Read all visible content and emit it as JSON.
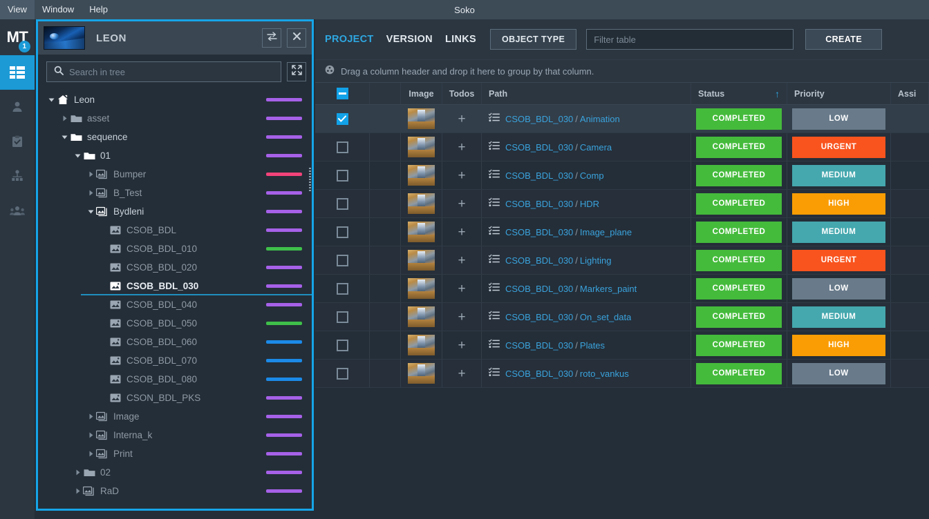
{
  "window": {
    "title": "Soko"
  },
  "menubar": {
    "items": [
      {
        "label": "View"
      },
      {
        "label": "Window"
      },
      {
        "label": "Help"
      }
    ]
  },
  "rail": {
    "logo_text": "MT",
    "badge_count": "1",
    "items": [
      {
        "name": "grid-icon",
        "label": "Projects",
        "active": true
      },
      {
        "name": "user-icon",
        "label": "User",
        "active": false
      },
      {
        "name": "clipboard-check-icon",
        "label": "Tasks",
        "active": false
      },
      {
        "name": "person-network-icon",
        "label": "Assignments",
        "active": false
      },
      {
        "name": "group-users-icon",
        "label": "Teams",
        "active": false
      }
    ]
  },
  "tree_panel": {
    "title": "LEON",
    "thumbnail_alt": "leon-project-thumbnail",
    "swap_button_label": "⇄",
    "close_button_label": "✕",
    "collapse_button_label": "collapse-all",
    "search": {
      "placeholder": "Search in tree",
      "value": ""
    },
    "nodes": [
      {
        "label": "Leon",
        "depth": 0,
        "icon": "home-icon",
        "caret": "down",
        "color": "#a661e8",
        "emphasis": "mid"
      },
      {
        "label": "asset",
        "depth": 1,
        "icon": "folder-icon",
        "caret": "right",
        "color": "#a661e8",
        "emphasis": "dim"
      },
      {
        "label": "sequence",
        "depth": 1,
        "icon": "folder-icon",
        "caret": "down",
        "color": "#a661e8",
        "emphasis": "mid"
      },
      {
        "label": "01",
        "depth": 2,
        "icon": "folder-icon",
        "caret": "down",
        "color": "#a661e8",
        "emphasis": "mid"
      },
      {
        "label": "Bumper",
        "depth": 3,
        "icon": "shots-icon",
        "caret": "right",
        "color": "#f2437a",
        "emphasis": "dim"
      },
      {
        "label": "B_Test",
        "depth": 3,
        "icon": "shots-icon",
        "caret": "right",
        "color": "#a661e8",
        "emphasis": "dim"
      },
      {
        "label": "Bydleni",
        "depth": 3,
        "icon": "shots-icon",
        "caret": "down",
        "color": "#a661e8",
        "emphasis": "mid"
      },
      {
        "label": "CSOB_BDL",
        "depth": 4,
        "icon": "shot-icon",
        "caret": "none",
        "color": "#a661e8",
        "emphasis": "dim"
      },
      {
        "label": "CSOB_BDL_010",
        "depth": 4,
        "icon": "shot-icon",
        "caret": "none",
        "color": "#3fc04a",
        "emphasis": "dim"
      },
      {
        "label": "CSOB_BDL_020",
        "depth": 4,
        "icon": "shot-icon",
        "caret": "none",
        "color": "#a661e8",
        "emphasis": "dim"
      },
      {
        "label": "CSOB_BDL_030",
        "depth": 4,
        "icon": "shot-icon",
        "caret": "none",
        "color": "#a661e8",
        "emphasis": "selected"
      },
      {
        "label": "CSOB_BDL_040",
        "depth": 4,
        "icon": "shot-icon",
        "caret": "none",
        "color": "#a661e8",
        "emphasis": "dim"
      },
      {
        "label": "CSOB_BDL_050",
        "depth": 4,
        "icon": "shot-icon",
        "caret": "none",
        "color": "#3fc04a",
        "emphasis": "dim"
      },
      {
        "label": "CSOB_BDL_060",
        "depth": 4,
        "icon": "shot-icon",
        "caret": "none",
        "color": "#1b8ae8",
        "emphasis": "dim"
      },
      {
        "label": "CSOB_BDL_070",
        "depth": 4,
        "icon": "shot-icon",
        "caret": "none",
        "color": "#1b8ae8",
        "emphasis": "dim"
      },
      {
        "label": "CSOB_BDL_080",
        "depth": 4,
        "icon": "shot-icon",
        "caret": "none",
        "color": "#1b8ae8",
        "emphasis": "dim"
      },
      {
        "label": "CSON_BDL_PKS",
        "depth": 4,
        "icon": "shot-icon",
        "caret": "none",
        "color": "#a661e8",
        "emphasis": "dim"
      },
      {
        "label": "Image",
        "depth": 3,
        "icon": "shots-icon",
        "caret": "right",
        "color": "#a661e8",
        "emphasis": "dim"
      },
      {
        "label": "Interna_k",
        "depth": 3,
        "icon": "shots-icon",
        "caret": "right",
        "color": "#a661e8",
        "emphasis": "dim"
      },
      {
        "label": "Print",
        "depth": 3,
        "icon": "shots-icon",
        "caret": "right",
        "color": "#a661e8",
        "emphasis": "dim"
      },
      {
        "label": "02",
        "depth": 2,
        "icon": "folder-icon",
        "caret": "right",
        "color": "#a661e8",
        "emphasis": "dim"
      },
      {
        "label": "RaD",
        "depth": 2,
        "icon": "shots-icon",
        "caret": "right",
        "color": "#a661e8",
        "emphasis": "dim"
      }
    ]
  },
  "toolbar": {
    "tabs": [
      {
        "label": "PROJECT",
        "active": true
      },
      {
        "label": "VERSION",
        "active": false
      },
      {
        "label": "LINKS",
        "active": false
      }
    ],
    "object_type_label": "OBJECT TYPE",
    "filter": {
      "placeholder": "Filter table",
      "value": ""
    },
    "create_label": "CREATE"
  },
  "group_bar": {
    "icon": "group-drop-icon",
    "text": "Drag a column header and drop it here to group by that column."
  },
  "table": {
    "select_all_state": "indeterminate",
    "columns": [
      {
        "key": "checkbox",
        "label": ""
      },
      {
        "key": "blank",
        "label": ""
      },
      {
        "key": "image",
        "label": "Image"
      },
      {
        "key": "todos",
        "label": "Todos"
      },
      {
        "key": "path",
        "label": "Path"
      },
      {
        "key": "status",
        "label": "Status",
        "sort": "asc",
        "sort_glyph": "↑"
      },
      {
        "key": "priority",
        "label": "Priority"
      },
      {
        "key": "assignee",
        "label": "Assi"
      }
    ],
    "rows": [
      {
        "selected": true,
        "path_prefix": "CSOB_BDL_030",
        "path_name": "Animation",
        "status": "COMPLETED",
        "priority": "LOW",
        "status_color": "#45bb3c",
        "priority_color": "#697b8b"
      },
      {
        "selected": false,
        "path_prefix": "CSOB_BDL_030",
        "path_name": "Camera",
        "status": "COMPLETED",
        "priority": "URGENT",
        "status_color": "#45bb3c",
        "priority_color": "#f9541e"
      },
      {
        "selected": false,
        "path_prefix": "CSOB_BDL_030",
        "path_name": "Comp",
        "status": "COMPLETED",
        "priority": "MEDIUM",
        "status_color": "#45bb3c",
        "priority_color": "#44a8ae"
      },
      {
        "selected": false,
        "path_prefix": "CSOB_BDL_030",
        "path_name": "HDR",
        "status": "COMPLETED",
        "priority": "HIGH",
        "status_color": "#45bb3c",
        "priority_color": "#fa9d04"
      },
      {
        "selected": false,
        "path_prefix": "CSOB_BDL_030",
        "path_name": "Image_plane",
        "status": "COMPLETED",
        "priority": "MEDIUM",
        "status_color": "#45bb3c",
        "priority_color": "#44a8ae"
      },
      {
        "selected": false,
        "path_prefix": "CSOB_BDL_030",
        "path_name": "Lighting",
        "status": "COMPLETED",
        "priority": "URGENT",
        "status_color": "#45bb3c",
        "priority_color": "#f9541e"
      },
      {
        "selected": false,
        "path_prefix": "CSOB_BDL_030",
        "path_name": "Markers_paint",
        "status": "COMPLETED",
        "priority": "LOW",
        "status_color": "#45bb3c",
        "priority_color": "#697b8b"
      },
      {
        "selected": false,
        "path_prefix": "CSOB_BDL_030",
        "path_name": "On_set_data",
        "status": "COMPLETED",
        "priority": "MEDIUM",
        "status_color": "#45bb3c",
        "priority_color": "#44a8ae"
      },
      {
        "selected": false,
        "path_prefix": "CSOB_BDL_030",
        "path_name": "Plates",
        "status": "COMPLETED",
        "priority": "HIGH",
        "status_color": "#45bb3c",
        "priority_color": "#fa9d04"
      },
      {
        "selected": false,
        "path_prefix": "CSOB_BDL_030",
        "path_name": "roto_vankus",
        "status": "COMPLETED",
        "priority": "LOW",
        "status_color": "#45bb3c",
        "priority_color": "#697b8b"
      }
    ],
    "add_todo_glyph": "+",
    "path_separator": "/"
  },
  "colors": {
    "accent_blue": "#15a5e8",
    "link_blue": "#3aa3dd",
    "panel_bg": "#242e38",
    "header_bg": "#2b3641"
  }
}
